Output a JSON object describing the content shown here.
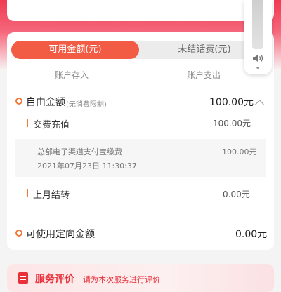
{
  "tabs": {
    "available": "可用金额(元)",
    "unsettled": "未结话费(元)"
  },
  "columns": {
    "deposit": "账户存入",
    "expense": "账户支出"
  },
  "free_amount": {
    "label": "自由金额",
    "note": "(无消费限制)",
    "value": "100.00元"
  },
  "recharge": {
    "label": "交费充值",
    "value": "100.00元",
    "detail": {
      "channel": "总部电子渠道支付宝缴费",
      "datetime": "2021年07月23日 11:30:37",
      "amount": "100.00元"
    }
  },
  "last_month": {
    "label": "上月结转",
    "value": "0.00元"
  },
  "directed_amount": {
    "label": "可使用定向金额",
    "value": "0.00元"
  },
  "service_eval": {
    "title": "服务评价",
    "subtitle": "请为本次服务进行评价"
  },
  "volume": {
    "icon": "speaker-icon"
  },
  "colors": {
    "accent": "#f25c45",
    "brand_red": "#f03a52",
    "dot": "#f07a3a"
  }
}
